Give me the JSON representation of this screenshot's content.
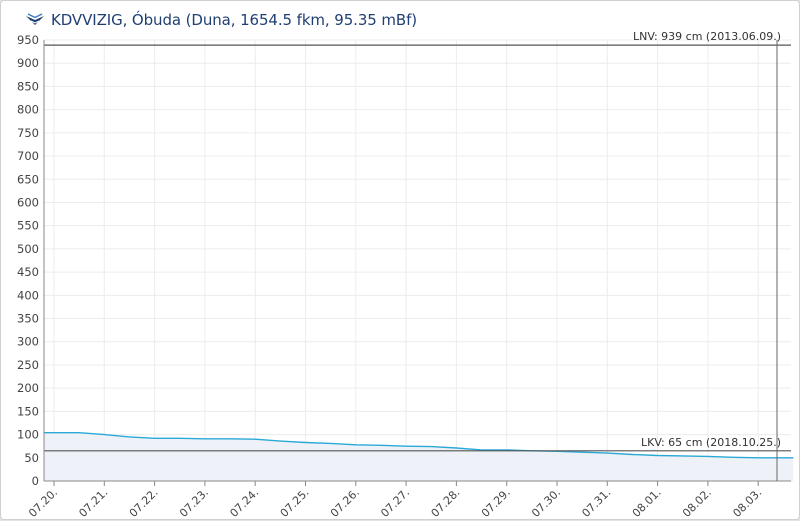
{
  "header": {
    "title": "KDVVIZIG, Óbuda (Duna, 1654.5 fkm, 95.35 mBf)",
    "logo_icon": "kdvvizig-logo-icon"
  },
  "colors": {
    "title": "#1f3f73",
    "line": "#2aa9d6",
    "fill": "#eef2f8",
    "grid": "#ececec",
    "ref_line": "#555555"
  },
  "chart_data": {
    "type": "area",
    "ylim": [
      0,
      950
    ],
    "y_ticks": [
      "0",
      "50",
      "100",
      "150",
      "200",
      "250",
      "300",
      "350",
      "400",
      "450",
      "500",
      "550",
      "600",
      "650",
      "700",
      "750",
      "800",
      "850",
      "900",
      "950"
    ],
    "y_tick_values": [
      0,
      50,
      100,
      150,
      200,
      250,
      300,
      350,
      400,
      450,
      500,
      550,
      600,
      650,
      700,
      750,
      800,
      850,
      900,
      950
    ],
    "x_ticks": [
      "07.20.",
      "07.21.",
      "07.22.",
      "07.23.",
      "07.24.",
      "07.25.",
      "07.26.",
      "07.27.",
      "07.28.",
      "07.29.",
      "07.30.",
      "07.31.",
      "08.01.",
      "08.02.",
      "08.03."
    ],
    "xlim": [
      "07.20.",
      "08.03."
    ],
    "grid": true,
    "series": [
      {
        "x": [
          "07.20.",
          "07.20.",
          "07.21.",
          "07.21.",
          "07.22.",
          "07.22.",
          "07.23.",
          "07.23.",
          "07.24.",
          "07.24.",
          "07.25.",
          "07.25.",
          "07.26.",
          "07.26.",
          "07.27.",
          "07.27.",
          "07.28.",
          "07.28.",
          "07.29.",
          "07.29.",
          "07.30.",
          "07.30.",
          "07.31.",
          "07.31.",
          "08.01.",
          "08.01.",
          "08.02.",
          "08.02.",
          "08.03.",
          "08.03."
        ],
        "x_fraction": [
          0.0,
          0.5,
          0.0,
          0.5,
          0.0,
          0.5,
          0.0,
          0.5,
          0.0,
          0.5,
          0.0,
          0.5,
          0.0,
          0.5,
          0.0,
          0.5,
          0.0,
          0.5,
          0.0,
          0.5,
          0.0,
          0.5,
          0.0,
          0.5,
          0.0,
          0.5,
          0.0,
          0.5,
          0.0,
          0.7
        ],
        "values": [
          104,
          104,
          100,
          95,
          92,
          92,
          91,
          91,
          90,
          86,
          83,
          81,
          78,
          77,
          75,
          74,
          71,
          67,
          67,
          65,
          64,
          62,
          60,
          57,
          55,
          54,
          53,
          51,
          50,
          50
        ]
      }
    ],
    "reference_lines": [
      {
        "value": 939,
        "label": "LNV: 939 cm (2013.06.09.)"
      },
      {
        "value": 65,
        "label": "LKV: 65 cm (2018.10.25.)"
      }
    ]
  }
}
